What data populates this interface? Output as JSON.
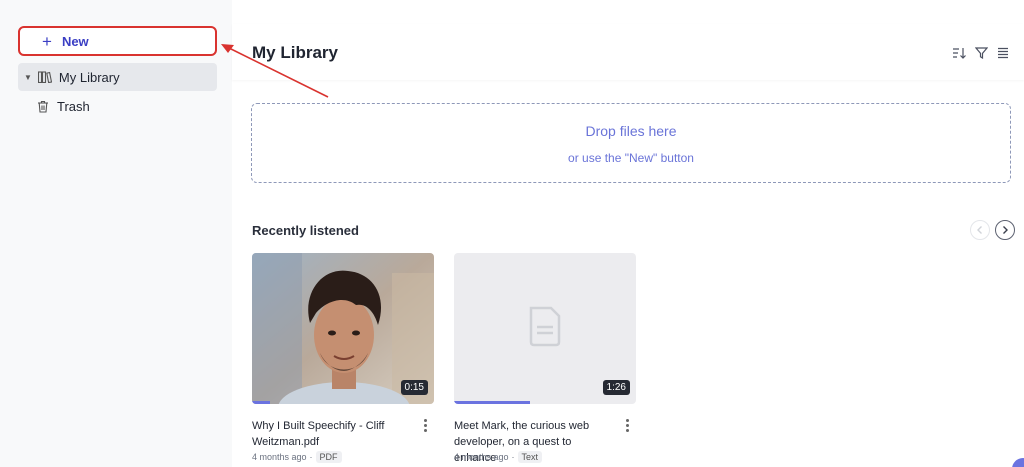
{
  "sidebar": {
    "new_button": {
      "label": "New"
    },
    "items": [
      {
        "label": "My Library",
        "icon": "library-icon",
        "active": true
      },
      {
        "label": "Trash",
        "icon": "trash-icon",
        "active": false
      }
    ]
  },
  "header": {
    "title": "My Library",
    "icons": [
      "sort-icon",
      "filter-icon",
      "list-view-icon"
    ]
  },
  "dropzone": {
    "title": "Drop files here",
    "subtitle": "or use the \"New\" button"
  },
  "recent": {
    "title": "Recently listened",
    "cards": [
      {
        "title": "Why I Built Speechify - Cliff Weitzman.pdf",
        "duration": "0:15",
        "age": "4 months ago",
        "separator": "·",
        "type": "PDF",
        "progress": 0.1,
        "thumbnail": "photo"
      },
      {
        "title": "Meet Mark, the curious web developer, on a quest to enhance",
        "duration": "1:26",
        "age": "4 months ago",
        "separator": "·",
        "type": "Text",
        "progress": 0.42,
        "thumbnail": "document-icon"
      }
    ]
  },
  "colors": {
    "accent": "#6b73e0",
    "annotation": "#d9332f",
    "new_button_text": "#3b3fc4"
  }
}
